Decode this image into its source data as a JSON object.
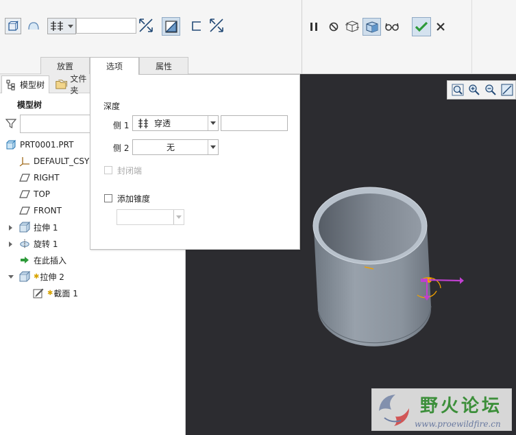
{
  "dashboard": {
    "depth_value": "",
    "tabs": [
      {
        "label": "放置"
      },
      {
        "label": "选项"
      },
      {
        "label": "属性"
      }
    ]
  },
  "left_panel": {
    "tabs": [
      {
        "label": "模型树"
      },
      {
        "label": "文件夹"
      }
    ],
    "tree_title": "模型树",
    "search_value": "",
    "tree": [
      {
        "label": "PRT0001.PRT",
        "icon": "part-icon"
      },
      {
        "label": "DEFAULT_CSYS",
        "icon": "csys-icon"
      },
      {
        "label": "RIGHT",
        "icon": "datum-plane-icon"
      },
      {
        "label": "TOP",
        "icon": "datum-plane-icon"
      },
      {
        "label": "FRONT",
        "icon": "datum-plane-icon"
      },
      {
        "label": "拉伸 1",
        "icon": "extrude-icon"
      },
      {
        "label": "旋转 1",
        "icon": "revolve-icon"
      },
      {
        "label": "在此插入",
        "icon": "insert-here-icon"
      },
      {
        "label": "拉伸 2",
        "icon": "extrude-icon"
      },
      {
        "label": "截面 1",
        "icon": "sketch-icon"
      }
    ]
  },
  "options_panel": {
    "depth_heading": "深度",
    "side1_label": "侧 1",
    "side1_value": "穿透",
    "side1_depth": "",
    "side2_label": "侧 2",
    "side2_value": "无",
    "capped_ends_label": "封闭端",
    "add_taper_label": "添加锥度",
    "taper_value": ""
  },
  "watermark": {
    "title": "野火论坛",
    "url": "www.proewildfire.cn"
  },
  "colors": {
    "accent_green": "#2e9a3a",
    "graphics_bg": "#2c2c30",
    "model_gray": "#8e97a2",
    "handle_magenta": "#c040d0",
    "handle_orange": "#f0a000"
  }
}
